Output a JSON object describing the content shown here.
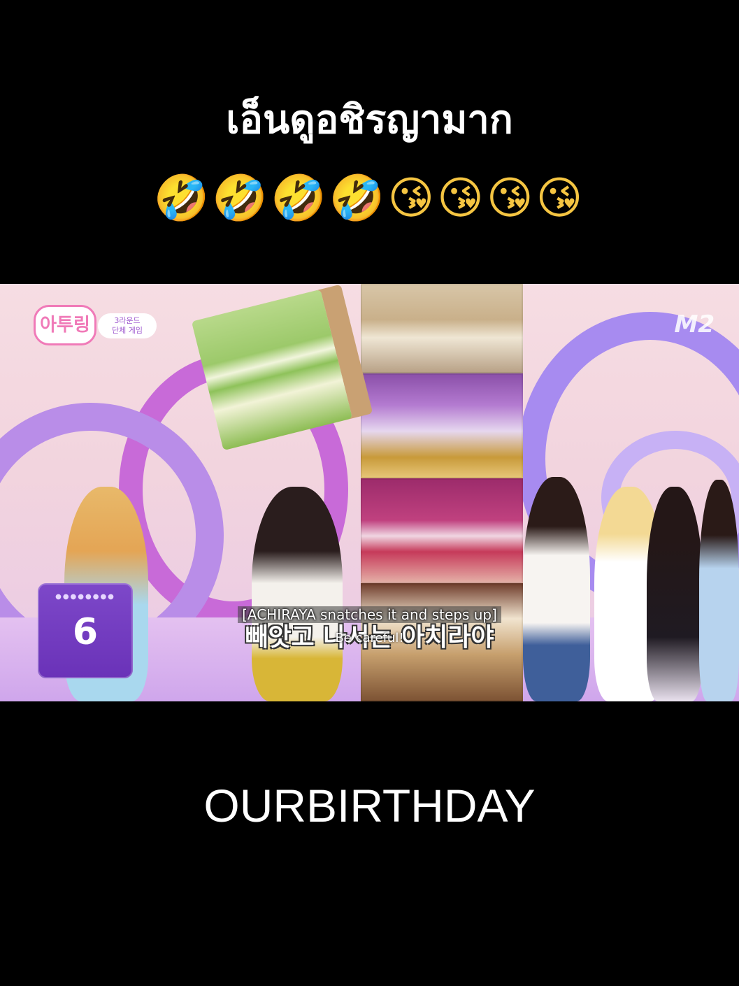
{
  "caption": {
    "title": "เอ็นดูอชิรญามาก",
    "emojis": "🤣🤣🤣🤣😘😘😘😘"
  },
  "video": {
    "show_logo": "아투링",
    "round_label": "3라운드",
    "round_sublabel": "단체 게임",
    "channel_logo": "M2",
    "counter": {
      "value": "6"
    },
    "subtitles": {
      "english_top": "[ACHIRAYA snatches it and steps up]",
      "korean": "빼앗고 나서는 아치라야",
      "english_overlay": "Be careful!"
    }
  },
  "footer": {
    "caption": "OURBIRTHDAY"
  },
  "colors": {
    "background": "#000000",
    "counter_card": "#6a32b8",
    "logo_pink": "#f07ab8"
  }
}
